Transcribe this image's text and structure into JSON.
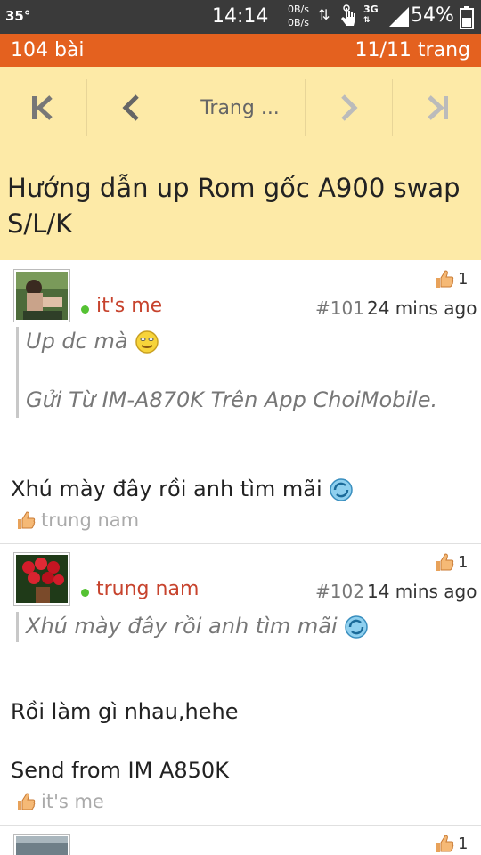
{
  "status_bar": {
    "temperature": "35°",
    "time": "14:14",
    "net_up": "0B/s",
    "net_down": "0B/s",
    "network": "3G",
    "battery": "54%"
  },
  "thread_bar": {
    "posts_count": "104 bài",
    "page_info": "11/11 trang"
  },
  "pager": {
    "page_label": "Trang ..."
  },
  "thread": {
    "title": "Hướng dẫn up Rom gốc A900 swap S/L/K"
  },
  "posts": [
    {
      "username": "it's me",
      "number": "#101",
      "time": "24 mins ago",
      "likes": "1",
      "quote_line1": "Up dc mà",
      "quote_line2": "Gửi Từ IM-A870K Trên App ChoiMobile.",
      "body": "Xhú mày đây rồi anh tìm mãi",
      "liked_by": "trung nam"
    },
    {
      "username": "trung nam",
      "number": "#102",
      "time": "14 mins ago",
      "likes": "1",
      "quote_line1": "Xhú mày đây rồi anh tìm mãi",
      "body_line1": "Rồi làm gì nhau,hehe",
      "body_line2": "Send from IM A850K",
      "liked_by": "it's me"
    },
    {
      "likes": "1"
    }
  ],
  "colors": {
    "status_bg": "#3a3a3a",
    "orange_bar": "#e4611f",
    "nav_bg": "#fdeaa7",
    "username": "#c7432d",
    "online": "#55c233"
  }
}
